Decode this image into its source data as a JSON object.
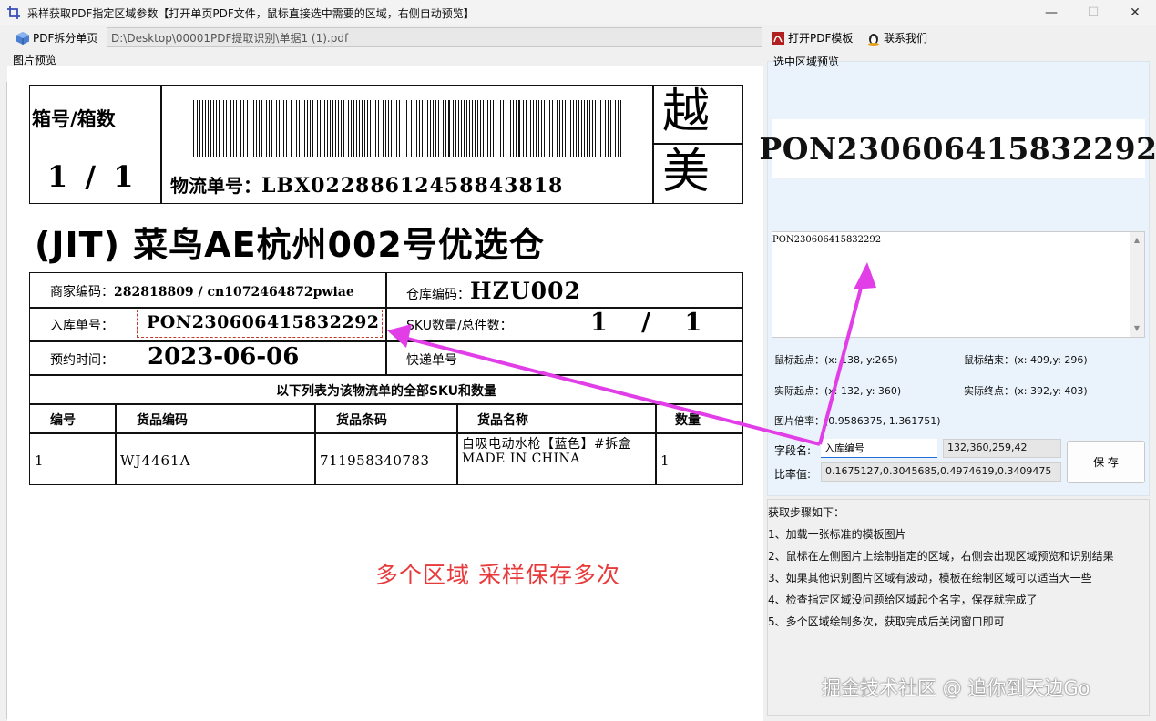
{
  "window": {
    "title": "采样获取PDF指定区域参数【打开单页PDF文件，鼠标直接选中需要的区域，右侧自动预览】",
    "min_icon": "minimize-icon",
    "max_icon": "maximize-icon",
    "close_icon": "close-icon"
  },
  "toolbar": {
    "split_label": "PDF拆分单页",
    "path_value": "D:\\Desktop\\00001PDF提取识别\\单据1 (1).pdf",
    "open_template_label": "打开PDF模板",
    "contact_label": "联系我们"
  },
  "left": {
    "label": "图片预览",
    "annotation": "多个区域  采样保存多次"
  },
  "doc": {
    "box_label": "箱号/箱数",
    "box_value": "1 / 1",
    "tracking_label": "物流单号：",
    "tracking_value": "LBX02288612458843818",
    "side_top": "越",
    "side_bottom": "美",
    "warehouse_title": "(JIT) 菜鸟AE杭州002号优选仓",
    "merchant_label": "商家编码：",
    "merchant_value": "282818809 / cn1072464872pwiae",
    "wh_code_label": "仓库编码：",
    "wh_code_value": "HZU002",
    "inbound_label": "入库单号：",
    "inbound_value": "PON230606415832292",
    "sku_label": "SKU数量/总件数：",
    "sku_value": "1 / 1",
    "appt_label": "预约时间：",
    "appt_value": "2023-06-06",
    "express_label": "快递单号",
    "list_caption": "以下列表为该物流单的全部SKU和数量",
    "table_headers": [
      "编号",
      "货品编码",
      "货品条码",
      "货品名称",
      "数量"
    ],
    "table_row": [
      "1",
      "WJ4461A",
      "711958340783",
      "自吸电动水枪【蓝色】#拆盒 MADE IN CHINA",
      "1"
    ]
  },
  "right": {
    "label": "选中区域预览",
    "crop_text": "PON230606415832292",
    "ocr_text": "PON230606415832292",
    "mouse_start": "鼠标起点：(x: 138, y:265)",
    "mouse_end": "鼠标结束：(x: 409,y: 296)",
    "actual_start": "实际起点：(x: 132, y: 360)",
    "actual_end": "实际终点：(x: 392,y: 403)",
    "ratio": "图片倍率：(0.9586375, 1.361751)",
    "field_name_label": "字段名:",
    "field_name_value": "入库编号",
    "coords_value": "132,360,259,42",
    "ratio_label": "比率值:",
    "ratio_value": "0.1675127,0.3045685,0.4974619,0.3409475",
    "save_label": "保 存"
  },
  "steps": {
    "title": "获取步骤如下：",
    "items": [
      "1、加载一张标准的模板图片",
      "2、鼠标在左侧图片上绘制指定的区域，右侧会出现区域预览和识别结果",
      "3、如果其他识别图片区域有波动，模板在绘制区域可以适当大一些",
      "4、检查指定区域没问题给区域起个名字，保存就完成了",
      "5、多个区域绘制多次，获取完成后关闭窗口即可"
    ]
  },
  "watermark": "掘金技术社区 @ 追你到天边Go",
  "colors": {
    "accent": "#1f6fd6",
    "annotation": "#e8393b",
    "arrow": "#e23ee8",
    "selection": "#c0392b"
  }
}
